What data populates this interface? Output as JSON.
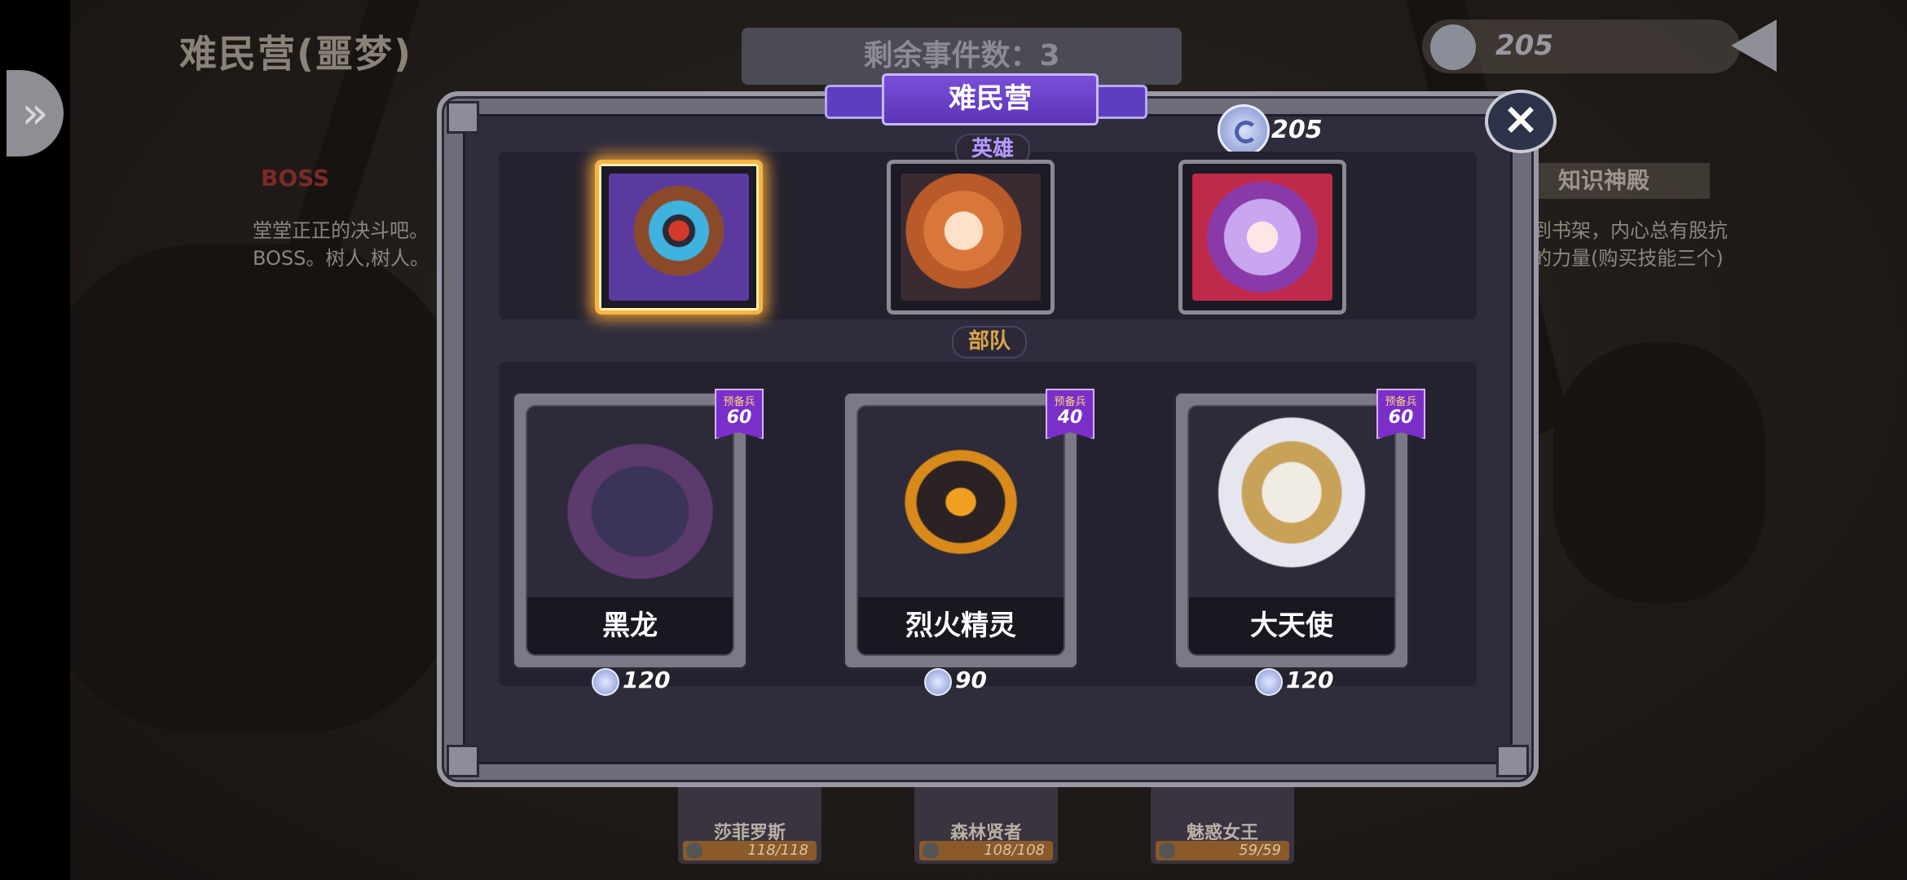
{
  "background": {
    "location_title": "难民营(噩梦)",
    "remaining_events": "剩余事件数：3",
    "currency_amount": "205",
    "left_event": {
      "tag": "BOSS",
      "desc_line1": "堂堂正正的决斗吧。",
      "desc_line2": "BOSS。树人,树人。"
    },
    "right_event": {
      "title": "知识神殿",
      "desc_line1": "到书架，内心总有股抗",
      "desc_line2": "的力量(购买技能三个)"
    },
    "roster": [
      {
        "name": "莎菲罗斯",
        "hp": "118/118"
      },
      {
        "name": "森林贤者",
        "hp": "108/108"
      },
      {
        "name": "魅惑女王",
        "hp": "59/59"
      }
    ]
  },
  "modal": {
    "title": "难民营",
    "currency_amount": "205",
    "hero_section_label": "英雄",
    "troop_section_label": "部队",
    "heroes": [
      {
        "portrait": "armored-robot-hero",
        "selected": true
      },
      {
        "portrait": "orange-haired-girl-hero",
        "selected": false
      },
      {
        "portrait": "demon-horned-girl-hero",
        "selected": false
      }
    ],
    "units": [
      {
        "name": "黑龙",
        "badge_label": "预备兵",
        "reserve": "60",
        "price": "120"
      },
      {
        "name": "烈火精灵",
        "badge_label": "预备兵",
        "reserve": "40",
        "price": "90"
      },
      {
        "name": "大天使",
        "badge_label": "预备兵",
        "reserve": "60",
        "price": "120"
      }
    ]
  },
  "colors": {
    "ribbon": "#6a44cc",
    "selected_glow": "#f5b544",
    "badge": "#7a2fc8",
    "section_label": "#d9a548"
  }
}
